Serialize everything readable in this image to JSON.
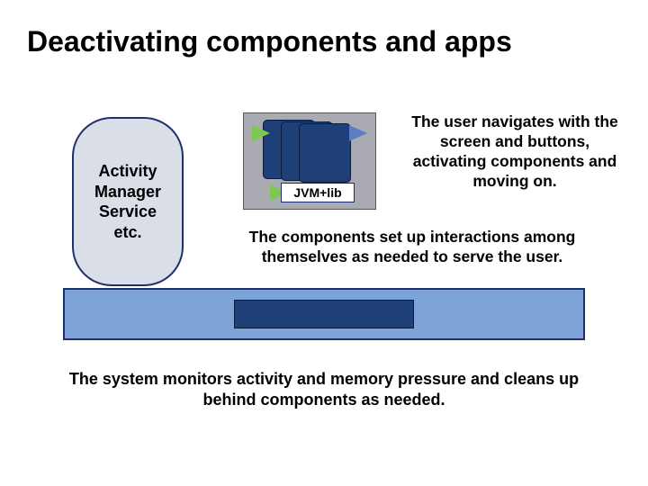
{
  "title": "Deactivating components and apps",
  "ams": {
    "line1": "Activity",
    "line2": "Manager",
    "line3": "Service",
    "line4": "etc."
  },
  "jvm": {
    "label": "JVM+lib"
  },
  "paras": {
    "right": "The user navigates with the screen and buttons, activating components and moving on.",
    "middle": "The components set up interactions among themselves as needed to serve the user.",
    "bottom": "The system monitors activity and memory pressure and cleans up behind components as needed."
  }
}
